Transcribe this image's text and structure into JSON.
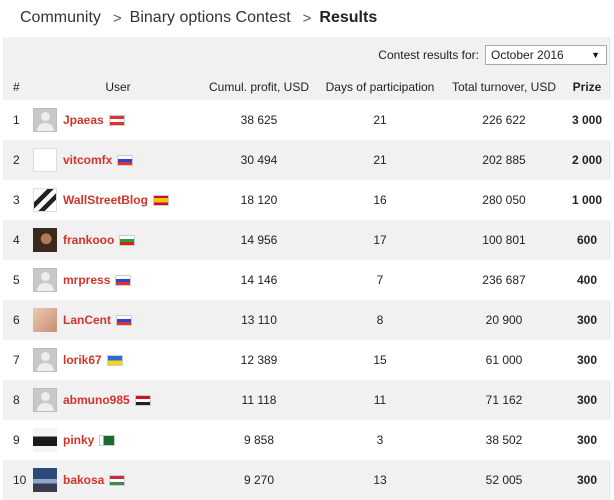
{
  "breadcrumb": {
    "items": [
      "Community",
      "Binary options Contest"
    ],
    "separator": ">",
    "current": "Results"
  },
  "filter": {
    "label": "Contest results for:",
    "selected": "October 2016"
  },
  "table": {
    "headers": {
      "rank": "#",
      "user": "User",
      "profit": "Cumul. profit, USD",
      "days": "Days of participation",
      "turnover": "Total turnover, USD",
      "prize": "Prize"
    },
    "rows": [
      {
        "rank": "1",
        "user": "Jpaeas",
        "flag": "austria-flag",
        "avatar": "default-avatar-icon",
        "profit": "38 625",
        "days": "21",
        "turnover": "226 622",
        "prize": "3 000"
      },
      {
        "rank": "2",
        "user": "vitcomfx",
        "flag": "russia-flag",
        "avatar": "fxp-logo-avatar",
        "profit": "30 494",
        "days": "21",
        "turnover": "202 885",
        "prize": "2 000"
      },
      {
        "rank": "3",
        "user": "WallStreetBlog",
        "flag": "spain-flag",
        "avatar": "bull-bear-avatar",
        "profit": "18 120",
        "days": "16",
        "turnover": "280 050",
        "prize": "1 000"
      },
      {
        "rank": "4",
        "user": "frankooo",
        "flag": "bulgaria-flag",
        "avatar": "portrait-avatar",
        "profit": "14 956",
        "days": "17",
        "turnover": "100 801",
        "prize": "600"
      },
      {
        "rank": "5",
        "user": "mrpress",
        "flag": "russia-flag",
        "avatar": "default-avatar-icon",
        "profit": "14 146",
        "days": "7",
        "turnover": "236 687",
        "prize": "400"
      },
      {
        "rank": "6",
        "user": "LanCent",
        "flag": "russia-flag",
        "avatar": "photo-avatar",
        "profit": "13 110",
        "days": "8",
        "turnover": "20 900",
        "prize": "300"
      },
      {
        "rank": "7",
        "user": "lorik67",
        "flag": "ukraine-flag",
        "avatar": "default-avatar-icon",
        "profit": "12 389",
        "days": "15",
        "turnover": "61 000",
        "prize": "300"
      },
      {
        "rank": "8",
        "user": "abmuno985",
        "flag": "egypt-flag",
        "avatar": "default-avatar-icon",
        "profit": "11 118",
        "days": "11",
        "turnover": "71 162",
        "prize": "300"
      },
      {
        "rank": "9",
        "user": "pinky",
        "flag": "pakistan-flag",
        "avatar": "car-avatar",
        "profit": "9 858",
        "days": "3",
        "turnover": "38 502",
        "prize": "300"
      },
      {
        "rank": "10",
        "user": "bakosa",
        "flag": "hungary-flag",
        "avatar": "landscape-avatar",
        "profit": "9 270",
        "days": "13",
        "turnover": "52 005",
        "prize": "300"
      }
    ]
  },
  "colors": {
    "username": "#d0342c",
    "row_alt": "#f1f1f1"
  }
}
